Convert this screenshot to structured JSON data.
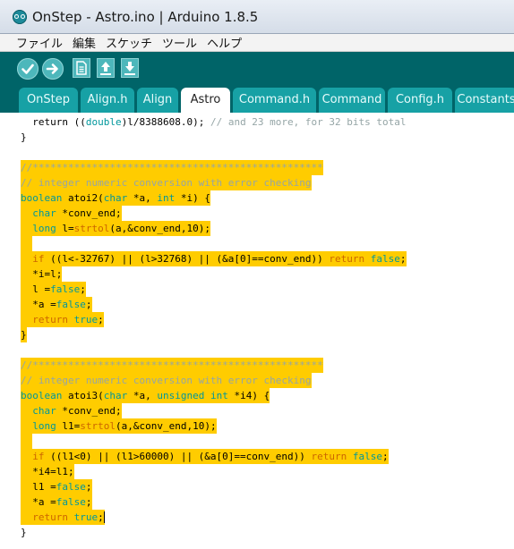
{
  "window": {
    "title": "OnStep - Astro.ino | Arduino 1.8.5"
  },
  "menu": [
    "ファイル",
    "編集",
    "スケッチ",
    "ツール",
    "ヘルプ"
  ],
  "toolbar": {
    "buttons": [
      "verify-icon",
      "upload-icon",
      "new-icon",
      "open-icon",
      "save-icon"
    ]
  },
  "tabs": [
    "OnStep",
    "Align.h",
    "Align",
    "Astro",
    "Command.h",
    "Command",
    "Config.h",
    "Constants"
  ],
  "active_tab": "Astro",
  "colors": {
    "toolbar_bg": "#006468",
    "tab_bg": "#17a1a5",
    "highlight": "#ffcc00",
    "keyword": "#cc6600",
    "type": "#00979c",
    "comment": "#95a5a6"
  },
  "code": [
    {
      "hl": false,
      "segs": [
        [
          "",
          "  return (("
        ],
        [
          "ty",
          "double"
        ],
        [
          "",
          ")l/8388608.0); "
        ],
        [
          "cm",
          "// and 23 more, for 32 bits total"
        ]
      ]
    },
    {
      "hl": false,
      "segs": [
        [
          "",
          "}"
        ]
      ]
    },
    {
      "hl": false,
      "segs": [
        [
          "",
          ""
        ]
      ]
    },
    {
      "hl": true,
      "segs": [
        [
          "cm",
          "//*************************************************"
        ]
      ]
    },
    {
      "hl": true,
      "segs": [
        [
          "cm",
          "// integer numeric conversion with error checking"
        ]
      ]
    },
    {
      "hl": true,
      "segs": [
        [
          "ty",
          "boolean"
        ],
        [
          "",
          " atoi2("
        ],
        [
          "ty",
          "char"
        ],
        [
          "",
          " *a, "
        ],
        [
          "ty",
          "int"
        ],
        [
          "",
          " *i) {"
        ]
      ]
    },
    {
      "hl": true,
      "segs": [
        [
          "",
          "  "
        ],
        [
          "ty",
          "char"
        ],
        [
          "",
          " *conv_end;"
        ]
      ]
    },
    {
      "hl": true,
      "segs": [
        [
          "",
          "  "
        ],
        [
          "ty",
          "long"
        ],
        [
          "",
          " l="
        ],
        [
          "kw",
          "strtol"
        ],
        [
          "",
          "(a,&conv_end,10);"
        ]
      ]
    },
    {
      "hl": true,
      "segs": [
        [
          "",
          "  "
        ]
      ]
    },
    {
      "hl": true,
      "segs": [
        [
          "",
          "  "
        ],
        [
          "kw",
          "if"
        ],
        [
          "",
          " ((l<-32767) || (l>32768) || (&a[0]==conv_end)) "
        ],
        [
          "kw",
          "return"
        ],
        [
          "",
          " "
        ],
        [
          "ty",
          "false"
        ],
        [
          "",
          ";"
        ]
      ]
    },
    {
      "hl": true,
      "segs": [
        [
          "",
          "  *i=l;"
        ]
      ]
    },
    {
      "hl": true,
      "segs": [
        [
          "",
          "  l ="
        ],
        [
          "ty",
          "false"
        ],
        [
          "",
          ";"
        ]
      ]
    },
    {
      "hl": true,
      "segs": [
        [
          "",
          "  *a ="
        ],
        [
          "ty",
          "false"
        ],
        [
          "",
          ";"
        ]
      ]
    },
    {
      "hl": true,
      "segs": [
        [
          "",
          "  "
        ],
        [
          "kw",
          "return"
        ],
        [
          "",
          " "
        ],
        [
          "ty",
          "true"
        ],
        [
          "",
          ";"
        ]
      ]
    },
    {
      "hl": true,
      "segs": [
        [
          "",
          "}"
        ]
      ]
    },
    {
      "hl": false,
      "segs": [
        [
          "",
          ""
        ]
      ]
    },
    {
      "hl": true,
      "segs": [
        [
          "cm",
          "//*************************************************"
        ]
      ]
    },
    {
      "hl": true,
      "segs": [
        [
          "cm",
          "// integer numeric conversion with error checking"
        ]
      ]
    },
    {
      "hl": true,
      "segs": [
        [
          "ty",
          "boolean"
        ],
        [
          "",
          " atoi3("
        ],
        [
          "ty",
          "char"
        ],
        [
          "",
          " *a, "
        ],
        [
          "ty",
          "unsigned"
        ],
        [
          "",
          " "
        ],
        [
          "ty",
          "int"
        ],
        [
          "",
          " *i4) {"
        ]
      ]
    },
    {
      "hl": true,
      "segs": [
        [
          "",
          "  "
        ],
        [
          "ty",
          "char"
        ],
        [
          "",
          " *conv_end;"
        ]
      ]
    },
    {
      "hl": true,
      "segs": [
        [
          "",
          "  "
        ],
        [
          "ty",
          "long"
        ],
        [
          "",
          " l1="
        ],
        [
          "kw",
          "strtol"
        ],
        [
          "",
          "(a,&conv_end,10);"
        ]
      ]
    },
    {
      "hl": true,
      "segs": [
        [
          "",
          "  "
        ]
      ]
    },
    {
      "hl": true,
      "segs": [
        [
          "",
          "  "
        ],
        [
          "kw",
          "if"
        ],
        [
          "",
          " ((l1<0) || (l1>60000) || (&a[0]==conv_end)) "
        ],
        [
          "kw",
          "return"
        ],
        [
          "",
          " "
        ],
        [
          "ty",
          "false"
        ],
        [
          "",
          ";"
        ]
      ]
    },
    {
      "hl": true,
      "segs": [
        [
          "",
          "  *i4=l1;"
        ]
      ]
    },
    {
      "hl": true,
      "segs": [
        [
          "",
          "  l1 ="
        ],
        [
          "ty",
          "false"
        ],
        [
          "",
          ";"
        ]
      ]
    },
    {
      "hl": true,
      "segs": [
        [
          "",
          "  *a ="
        ],
        [
          "ty",
          "false"
        ],
        [
          "",
          ";"
        ]
      ]
    },
    {
      "hl": true,
      "segs": [
        [
          "",
          "  "
        ],
        [
          "kw",
          "return"
        ],
        [
          "",
          " "
        ],
        [
          "ty",
          "true"
        ],
        [
          "",
          ";"
        ]
      ]
    },
    {
      "hl": false,
      "segs": [
        [
          "",
          "}"
        ]
      ]
    }
  ]
}
